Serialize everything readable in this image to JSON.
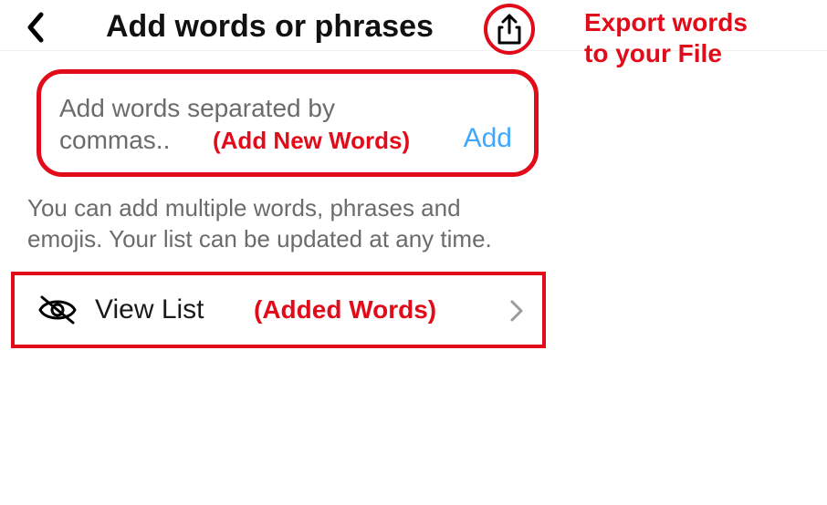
{
  "header": {
    "title": "Add words or phrases"
  },
  "annotations": {
    "export_line1": "Export words",
    "export_line2": "to your File",
    "add_new_words": "(Add New Words)",
    "added_words": "(Added Words)"
  },
  "input": {
    "placeholder_line1": "Add words separated by",
    "placeholder_line2": "commas..",
    "add_button_label": "Add"
  },
  "helper_text": "You can add multiple words, phrases and emojis. Your list can be updated at any time.",
  "view_list": {
    "label": "View List"
  },
  "icons": {
    "back": "chevron-left-icon",
    "export": "share-export-icon",
    "eye_off": "eye-off-icon",
    "chevron_right": "chevron-right-icon"
  }
}
